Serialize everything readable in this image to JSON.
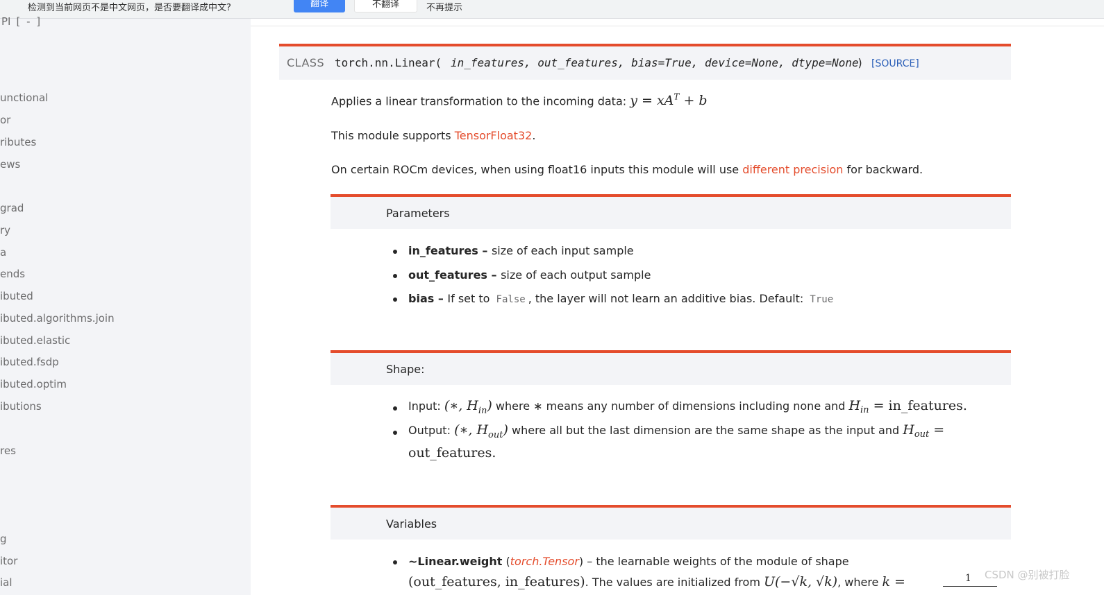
{
  "translate_bar": {
    "message": "检测到当前网页不是中文网页，是否要翻译成中文?",
    "translate_label": "翻译",
    "no_translate_label": "不翻译",
    "never_label": "不再提示"
  },
  "sidebar": {
    "api_label": "PI",
    "collapse_label": "[ - ]",
    "items": [
      "unctional",
      "or",
      "ributes",
      "ews",
      "grad",
      "ry",
      "a",
      "ends",
      "ibuted",
      "ibuted.algorithms.join",
      "ibuted.elastic",
      "ibuted.fsdp",
      "ibuted.optim",
      "ibutions",
      "res",
      "g",
      "itor",
      "ial"
    ]
  },
  "signature": {
    "keyword": "CLASS",
    "name": "torch.nn.Linear(",
    "params": "in_features, out_features, bias=True, device=None, dtype=None",
    "close": ")",
    "source_label": "[SOURCE]"
  },
  "description": {
    "line1": "Applies a linear transformation to the incoming data:",
    "line1_math": "y = xA",
    "line1_sup": "T",
    "line1_math_tail": " + b",
    "line2_pre": "This module supports ",
    "line2_link": "TensorFloat32",
    "line2_post": ".",
    "line3_pre": "On certain ROCm devices, when using float16 inputs this module will use ",
    "line3_link": "different precision",
    "line3_post": " for backward."
  },
  "parameters": {
    "heading": "Parameters",
    "items": [
      {
        "name": "in_features",
        "sep": " – ",
        "desc": "size of each input sample"
      },
      {
        "name": "out_features",
        "sep": " – ",
        "desc": "size of each output sample"
      },
      {
        "name": "bias",
        "sep": " – ",
        "desc_pre": "If set to ",
        "code1": "False",
        "desc_mid": ", the layer will not learn an additive bias. Default: ",
        "code2": "True"
      }
    ]
  },
  "shape": {
    "heading": "Shape:",
    "input_label": "Input: ",
    "input_math": "(∗, H",
    "input_sub": "in",
    "input_close": ")",
    "input_desc": " where ∗ means any number of dimensions including none and ",
    "input_eq_math": "H",
    "input_eq_sub": "in",
    "input_eq_rest": " = in_features.",
    "output_label": "Output: ",
    "output_math": "(∗, H",
    "output_sub": "out",
    "output_close": ")",
    "output_desc": " where all but the last dimension are the same shape as the input and ",
    "output_eq_math": "H",
    "output_eq_sub": "out",
    "output_eq_rest": " =",
    "output_line2": "out_features."
  },
  "variables": {
    "heading": "Variables",
    "item_name": "~Linear.weight",
    "item_type": "torch.Tensor",
    "item_desc": " – the learnable weights of the module of shape",
    "line2_math": "(out_features, in_features)",
    "line2_text": ". The values are initialized from ",
    "line2_math2": "U(−√k, √k)",
    "line2_where": ", where ",
    "line2_k": "k =",
    "line2_frac": "1"
  },
  "watermark": "CSDN @别被打脸"
}
